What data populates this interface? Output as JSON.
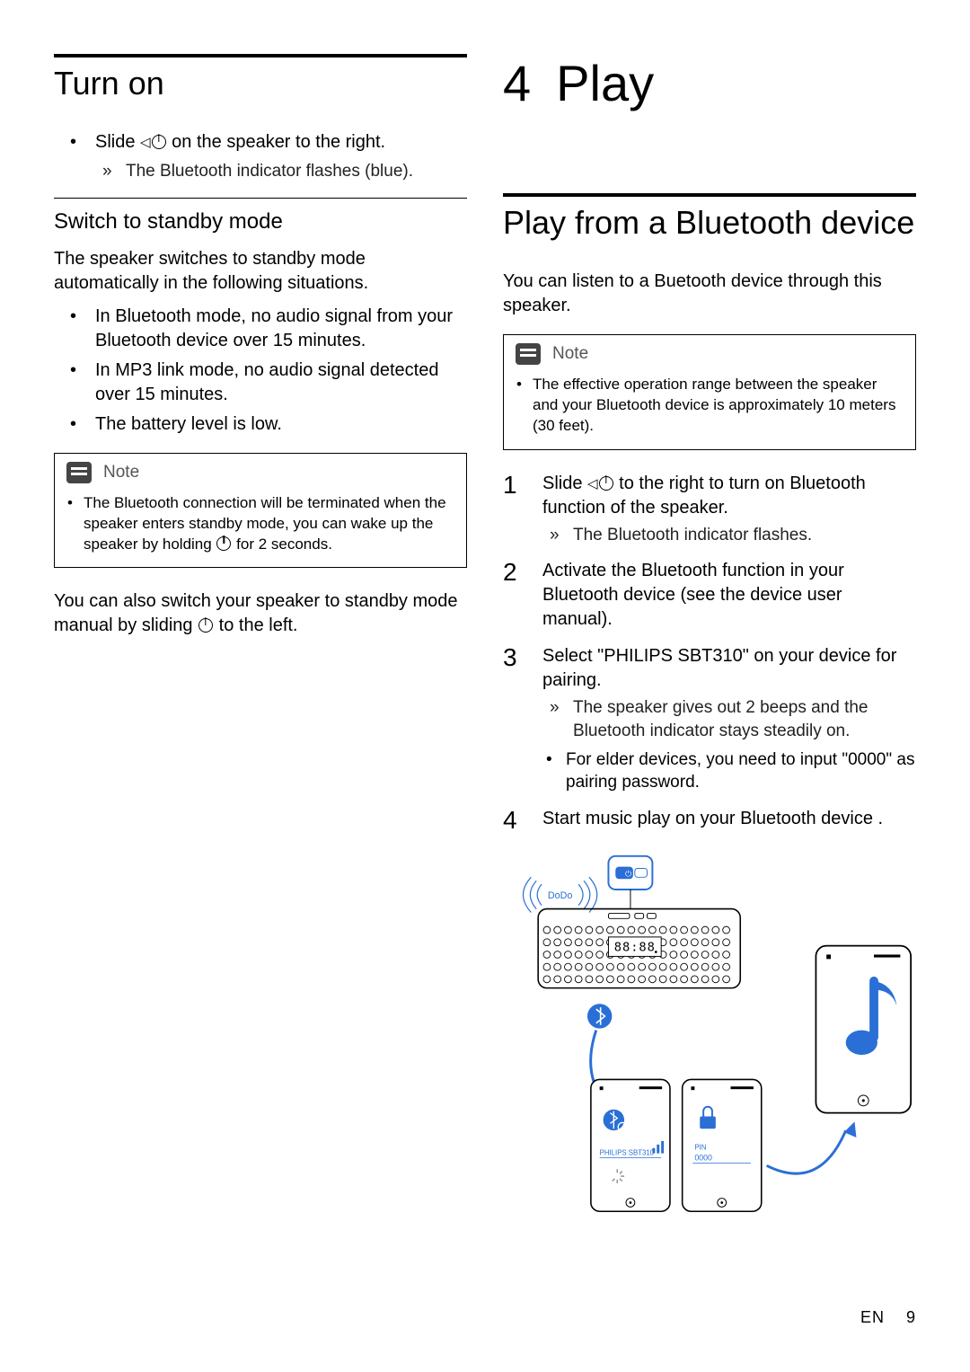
{
  "left": {
    "heading_turn_on": "Turn on",
    "turn_on_bullet": "Slide",
    "turn_on_bullet_tail": " on the speaker to the right.",
    "turn_on_result": "The Bluetooth indicator flashes (blue).",
    "standby_heading": "Switch to standby mode",
    "standby_intro": "The speaker switches to standby mode automatically in the following situations.",
    "standby_items": [
      "In Bluetooth mode, no audio signal from your Bluetooth device over 15 minutes.",
      "In MP3 link mode, no audio signal detected over 15 minutes.",
      "The battery level is low."
    ],
    "note_label": "Note",
    "note_text": "The Bluetooth connection will be terminated when the speaker enters standby mode, you can wake up the speaker by holding ",
    "note_text_tail": " for 2 seconds.",
    "manual_standby_a": "You can also switch your speaker to standby mode manual by sliding ",
    "manual_standby_b": " to the left."
  },
  "right": {
    "chapter_num": "4",
    "chapter_title": "Play",
    "heading_play_bt": "Play from a Bluetooth device",
    "intro": "You can listen to a Buetooth device through this speaker.",
    "note_label": "Note",
    "note_text": "The effective operation range between the speaker and your Bluetooth device is approximately 10 meters (30 feet).",
    "steps": {
      "s1_a": "Slide",
      "s1_b": " to the right to turn on Bluetooth function of the speaker.",
      "s1_result": "The Bluetooth indicator flashes.",
      "s2": "Activate the Bluetooth function in your Bluetooth device (see the device user manual).",
      "s3": "Select \"PHILIPS SBT310\" on your device for pairing.",
      "s3_result": "The speaker gives out 2 beeps and the Bluetooth indicator stays steadily on.",
      "s3_sub": "For elder devices, you need to input \"0000\" as pairing password.",
      "s4": "Start music play on your Bluetooth device ."
    },
    "diagram": {
      "dodo": "DoDo",
      "device_name": "PHILIPS SBT310",
      "pin_label": "PIN",
      "pin_value": "0000"
    }
  },
  "footer": {
    "lang": "EN",
    "page": "9"
  }
}
